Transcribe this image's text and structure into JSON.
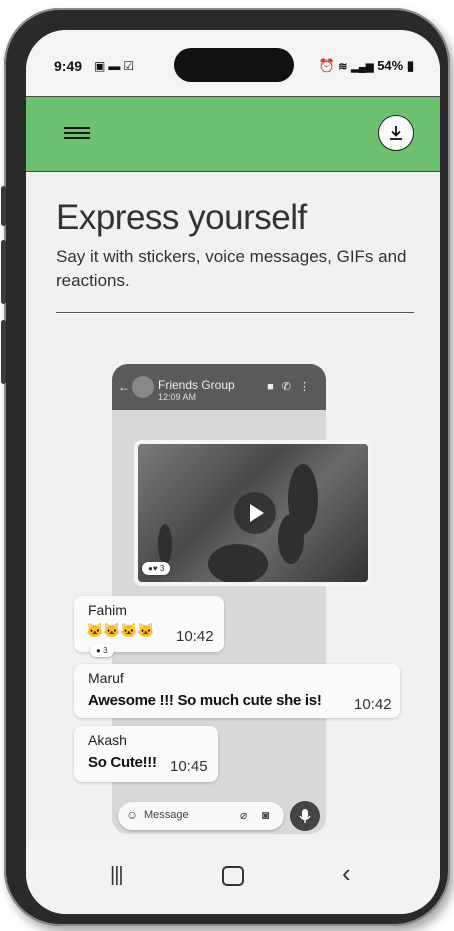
{
  "status_bar": {
    "time": "9:49",
    "left_icons": [
      "image-icon",
      "chat-icon",
      "check-box-icon"
    ],
    "battery": "54%",
    "right_icons": [
      "alarm-icon",
      "wifi-icon",
      "signal-icon",
      "signal-icon",
      "battery-icon"
    ]
  },
  "app_bar": {
    "color": "#6cc070",
    "menu_icon": "hamburger-icon",
    "download_icon": "download-icon"
  },
  "hero": {
    "title": "Express yourself",
    "subtitle": "Say it with stickers, voice messages, GIFs and reactions."
  },
  "preview": {
    "group_name": "Friends Group",
    "group_time": "12:09 AM",
    "video_reactions": "3",
    "messages": [
      {
        "name": "Fahim",
        "text": "🐱🐱🐱🐱",
        "time": "10:42",
        "reaction_count": "3"
      },
      {
        "name": "Maruf",
        "text": "Awesome !!! So much cute she is!",
        "time": "10:42"
      },
      {
        "name": "Akash",
        "text": "So Cute!!!",
        "time": "10:45"
      }
    ],
    "input_placeholder": "Message"
  },
  "nav_bar": {
    "recent_icon": "recent-apps-icon",
    "home_icon": "home-icon",
    "back_icon": "back-icon"
  }
}
